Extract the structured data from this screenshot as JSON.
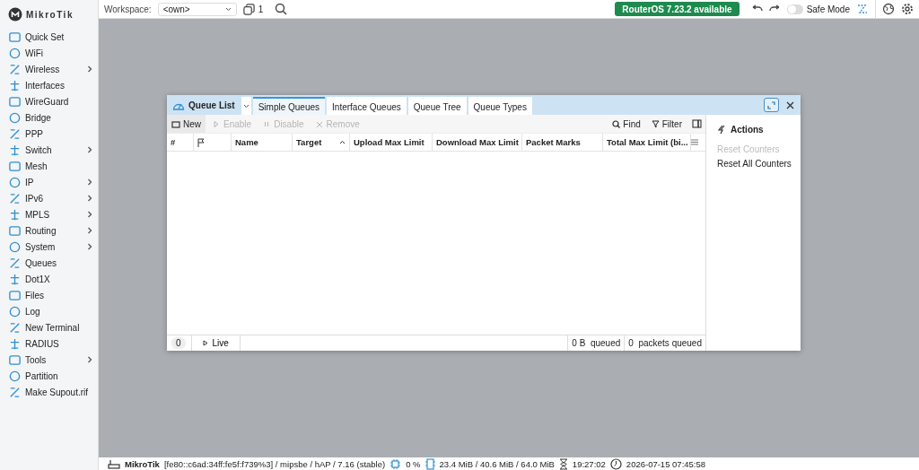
{
  "brand": "MikroTik",
  "sidebar": {
    "items": [
      {
        "label": "Quick Set",
        "expandable": false
      },
      {
        "label": "WiFi",
        "expandable": false
      },
      {
        "label": "Wireless",
        "expandable": true
      },
      {
        "label": "Interfaces",
        "expandable": false
      },
      {
        "label": "WireGuard",
        "expandable": false
      },
      {
        "label": "Bridge",
        "expandable": false
      },
      {
        "label": "PPP",
        "expandable": false
      },
      {
        "label": "Switch",
        "expandable": true
      },
      {
        "label": "Mesh",
        "expandable": false
      },
      {
        "label": "IP",
        "expandable": true
      },
      {
        "label": "IPv6",
        "expandable": true
      },
      {
        "label": "MPLS",
        "expandable": true
      },
      {
        "label": "Routing",
        "expandable": true
      },
      {
        "label": "System",
        "expandable": true
      },
      {
        "label": "Queues",
        "expandable": false
      },
      {
        "label": "Dot1X",
        "expandable": false
      },
      {
        "label": "Files",
        "expandable": false
      },
      {
        "label": "Log",
        "expandable": false
      },
      {
        "label": "New Terminal",
        "expandable": false
      },
      {
        "label": "RADIUS",
        "expandable": false
      },
      {
        "label": "Tools",
        "expandable": true
      },
      {
        "label": "Partition",
        "expandable": false
      },
      {
        "label": "Make Supout.rif",
        "expandable": false
      }
    ]
  },
  "topbar": {
    "workspace_label": "Workspace:",
    "workspace_value": "<own>",
    "window_count": "1",
    "update_badge": "RouterOS 7.23.2 available",
    "safe_mode": {
      "label": "Safe Mode",
      "on": false
    }
  },
  "window": {
    "title": "Queue List",
    "tabs": [
      {
        "label": "Simple Queues",
        "selected": true
      },
      {
        "label": "Interface Queues",
        "selected": false
      },
      {
        "label": "Queue Tree",
        "selected": false
      },
      {
        "label": "Queue Types",
        "selected": false
      }
    ],
    "toolbar": [
      {
        "label": "New",
        "disabled": false
      },
      {
        "label": "Enable",
        "disabled": true
      },
      {
        "label": "Disable",
        "disabled": true
      },
      {
        "label": "Remove",
        "disabled": true
      }
    ],
    "find": "Find",
    "filter": "Filter",
    "columns": [
      {
        "label": "#",
        "sorted": false
      },
      {
        "sorted": false
      },
      {
        "label": "Name",
        "sorted": false
      },
      {
        "label": "Target",
        "sorted": true
      },
      {
        "label": "Upload Max Limit",
        "sorted": false
      },
      {
        "label": "Download Max Limit",
        "sorted": false
      },
      {
        "label": "Packet Marks",
        "sorted": false
      },
      {
        "label": "Total Max Limit (bi...",
        "sorted": false
      }
    ],
    "footer": {
      "count": "0",
      "live": "Live",
      "bytes_queued": "0 B  queued",
      "packets_queued": "0  packets queued"
    },
    "actions": {
      "title": "Actions",
      "items": [
        {
          "label": "Reset Counters",
          "disabled": true
        },
        {
          "label": "Reset All Counters",
          "disabled": false
        }
      ]
    }
  },
  "status_bar": {
    "identity": "MikroTik",
    "device": "[fe80::c6ad:34ff:fe5f:f739%3] / mipsbe / hAP / 7.16 (stable)",
    "cpu": "0 %",
    "memory": "23.4 MiB / 40.6 MiB / 64.0 MiB",
    "uptime": "19:27:02",
    "datetime": "2026-07-15 07:45:58"
  }
}
